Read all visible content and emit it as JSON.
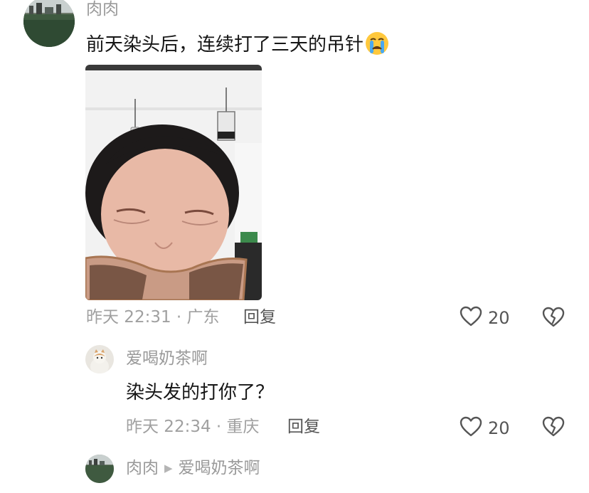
{
  "comments": [
    {
      "author": "肉肉",
      "text": "前天染头后，连续打了三天的吊针",
      "emoji": "crying-face-icon",
      "meta": "昨天 22:31 · 广东",
      "reply_label": "回复",
      "likes": "20"
    },
    {
      "author": "爱喝奶茶啊",
      "text": "染头发的打你了？",
      "meta": "昨天 22:34 · 重庆",
      "reply_label": "回复",
      "likes": "20"
    },
    {
      "author": "肉肉",
      "reply_to": "爱喝奶茶啊"
    }
  ],
  "colors": {
    "meta_gray": "#a0a0a0",
    "author_gray": "#9a9a9a",
    "text": "#161616"
  }
}
